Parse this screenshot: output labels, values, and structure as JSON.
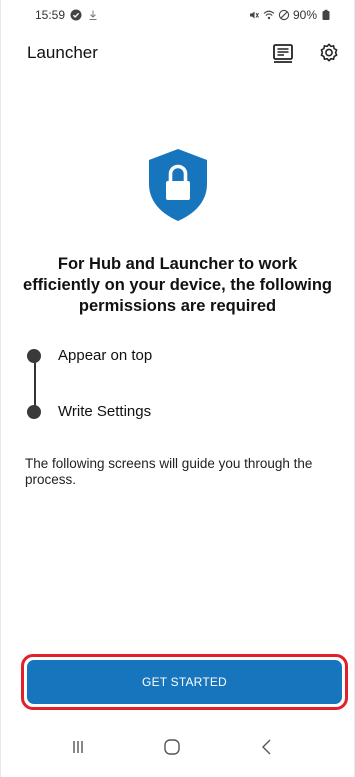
{
  "status_bar": {
    "time": "15:59",
    "battery": "90%",
    "icons": [
      "check-circle-icon",
      "download-icon",
      "mute-icon",
      "wifi-icon",
      "do-not-disturb-icon",
      "battery-icon"
    ]
  },
  "app_bar": {
    "title": "Launcher",
    "actions": [
      "news-icon",
      "settings-icon"
    ]
  },
  "hero": {
    "icon": "shield-lock-icon",
    "icon_color": "#1675bd"
  },
  "headline": "For Hub and Launcher to work efficiently on your device, the following permissions are required",
  "permissions": [
    {
      "label": "Appear on top"
    },
    {
      "label": "Write Settings"
    }
  ],
  "note": "The following screens will guide you through the process.",
  "cta": {
    "label": "GET STARTED",
    "color": "#1675bd",
    "highlight_color": "#e2202a"
  },
  "nav_bar": [
    "recents-icon",
    "home-icon",
    "back-icon"
  ]
}
